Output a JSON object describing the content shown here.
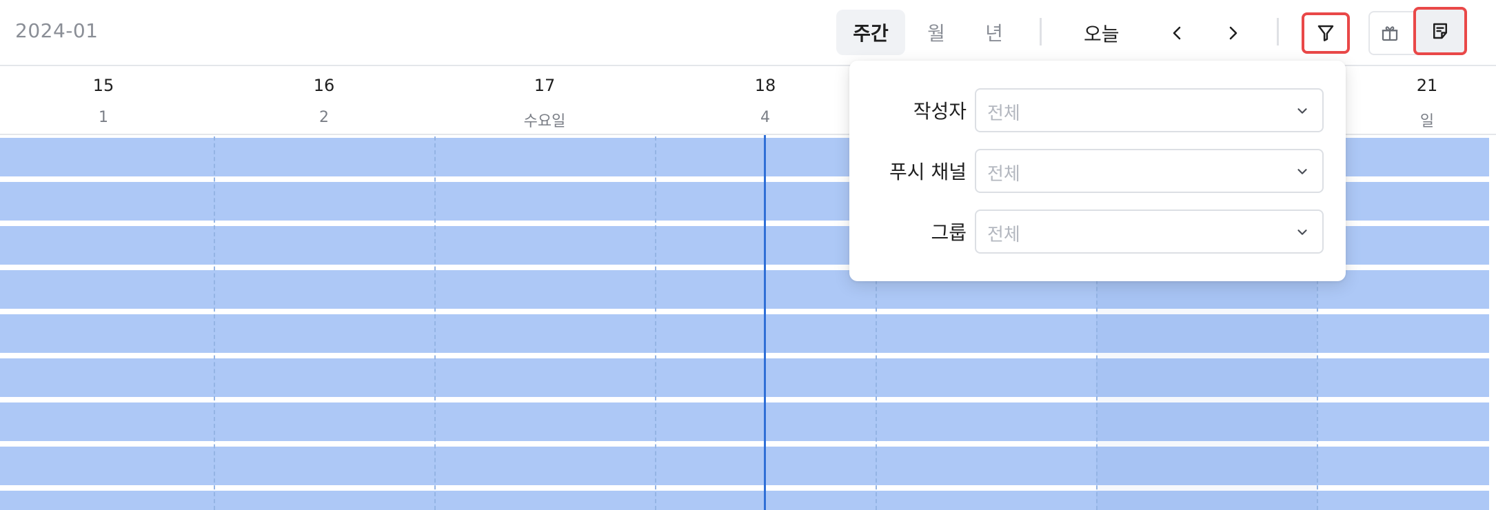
{
  "header": {
    "month": "2024-01",
    "views": [
      {
        "label": "주간",
        "active": true
      },
      {
        "label": "월",
        "active": false
      },
      {
        "label": "년",
        "active": false
      }
    ],
    "today_label": "오늘",
    "prev_icon": "chevron-left-icon",
    "next_icon": "chevron-right-icon",
    "filter_icon": "filter-icon",
    "gift_icon": "gift-icon",
    "note_icon": "note-icon"
  },
  "days": [
    {
      "num": "15",
      "sub": "1"
    },
    {
      "num": "16",
      "sub": "2"
    },
    {
      "num": "17",
      "sub": "수요일"
    },
    {
      "num": "18",
      "sub": "4"
    },
    {
      "num": "",
      "sub": ""
    },
    {
      "num": "",
      "sub": ""
    },
    {
      "num": "21",
      "sub": "일"
    }
  ],
  "filter": {
    "fields": [
      {
        "label": "작성자",
        "value": "전체"
      },
      {
        "label": "푸시 채널",
        "value": "전체"
      },
      {
        "label": "그룹",
        "value": "전체"
      }
    ]
  },
  "colors": {
    "event_bar": "#adc8f6",
    "now_line": "#2f6fd6",
    "highlight_border": "#e94848"
  }
}
